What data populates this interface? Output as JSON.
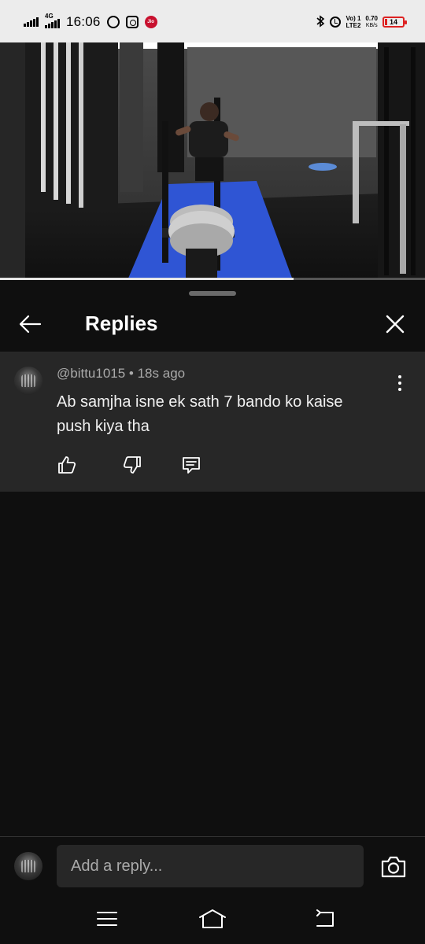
{
  "status_bar": {
    "network": "4G",
    "time": "16:06",
    "app_icons": [
      "swiggy-icon",
      "instagram-icon",
      "jio-icon"
    ],
    "jio_label": "Jio",
    "volte_top": "Vo) 1",
    "volte_bottom": "LTE2",
    "speed_value": "0.70",
    "speed_unit": "KB/s",
    "battery": "14",
    "battery_color": "#dd2222"
  },
  "video": {
    "progress": 0.69
  },
  "sheet": {
    "title": "Replies"
  },
  "comment": {
    "meta": "@bittu1015 • 18s ago",
    "text": "Ab samjha isne ek sath 7 bando ko kaise push kiya tha"
  },
  "reply_bar": {
    "placeholder": "Add a reply..."
  },
  "colors": {
    "background": "#0f0f0f",
    "comment_bg": "#272727",
    "muted_text": "#aaaaaa",
    "mat_blue": "#2f55d4"
  }
}
